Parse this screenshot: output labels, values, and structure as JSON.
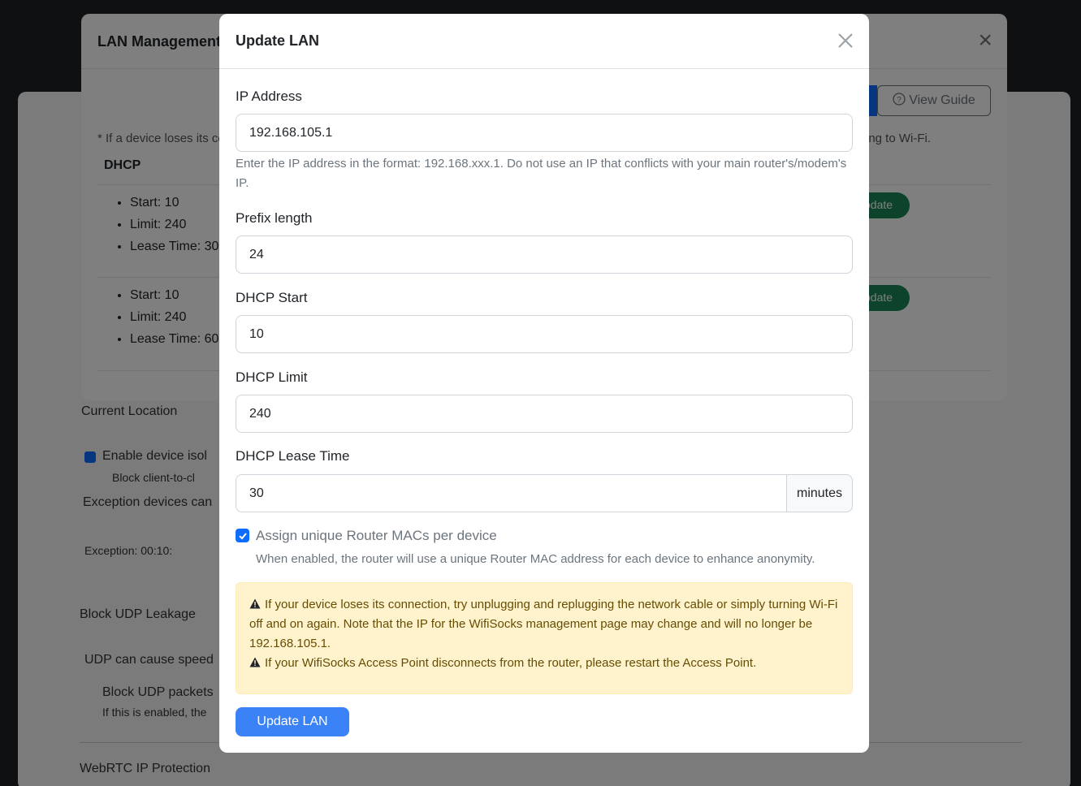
{
  "background": {
    "lines": [
      "Current Location",
      "Enable device isol",
      "Block client-to-cl",
      "Exception devices can",
      "Exception: 00:10:",
      "Block UDP Leakage",
      "UDP can cause speed",
      "Block UDP packets",
      "If this is enabled, the",
      "WebRTC IP Protection"
    ]
  },
  "lan_management": {
    "title": "LAN Management",
    "view_guide_label": "View Guide",
    "note_left": "* If a device loses its co",
    "note_right": "ing to Wi-Fi.",
    "dhcp_header": "DHCP",
    "entries": [
      {
        "start": "Start: 10",
        "limit": "Limit: 240",
        "lease": "Lease Time: 30",
        "update_label": "odate"
      },
      {
        "start": "Start: 10",
        "limit": "Limit: 240",
        "lease": "Lease Time: 60",
        "update_label": "odate"
      }
    ]
  },
  "update_lan": {
    "title": "Update LAN",
    "ip_address": {
      "label": "IP Address",
      "value": "192.168.105.1",
      "help": "Enter the IP address in the format: 192.168.xxx.1. Do not use an IP that conflicts with your main router's/modem's IP."
    },
    "prefix_length": {
      "label": "Prefix length",
      "value": "24"
    },
    "dhcp_start": {
      "label": "DHCP Start",
      "value": "10"
    },
    "dhcp_limit": {
      "label": "DHCP Limit",
      "value": "240"
    },
    "dhcp_lease_time": {
      "label": "DHCP Lease Time",
      "value": "30",
      "unit": "minutes"
    },
    "unique_macs": {
      "label": "Assign unique Router MACs per device",
      "help": "When enabled, the router will use a unique Router MAC address for each device to enhance anonymity.",
      "checked": true
    },
    "alert": {
      "line1": "If your device loses its connection, try unplugging and replugging the network cable or simply turning Wi-Fi off and on again. Note that the IP for the WifiSocks management page may change and will no longer be 192.168.105.1.",
      "line2": "If your WifiSocks Access Point disconnects from the router, please restart the Access Point."
    },
    "submit_label": "Update LAN"
  },
  "colors": {
    "primary": "#3b82f6",
    "checkbox": "#0d6efd",
    "alert_bg": "#fff3cd",
    "alert_text": "#664d03",
    "update_green": "#198754"
  }
}
